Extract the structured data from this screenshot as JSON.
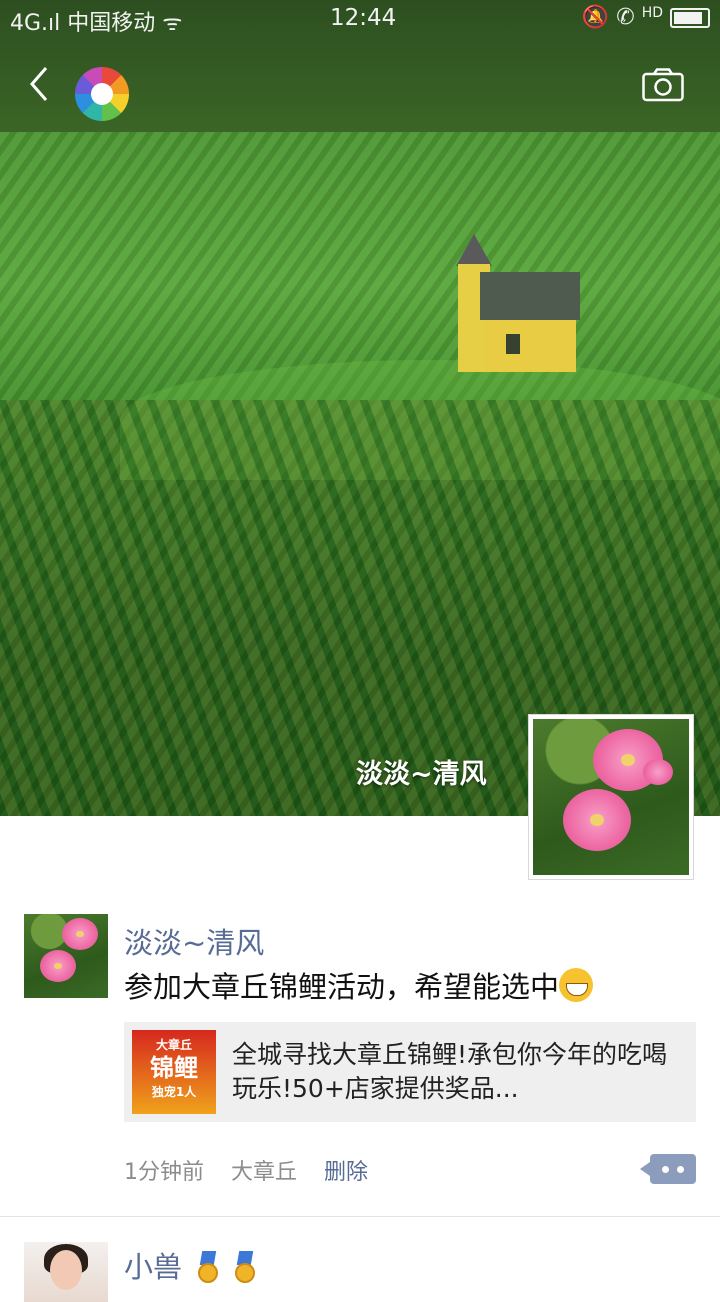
{
  "status_bar": {
    "carrier": "4G.ıl 中国移动 ᯤ",
    "time": "12:44",
    "hd": "HD"
  },
  "header": {
    "back_icon": "chevron-left-icon",
    "app_icon": "aperture-icon",
    "camera_icon": "camera-icon"
  },
  "cover": {
    "username": "淡淡~清风"
  },
  "post": {
    "author": "淡淡~清风",
    "text": "参加大章丘锦鲤活动，希望能选中",
    "emoji": "grinning-emoji",
    "link": {
      "thumb_top": "大章丘",
      "thumb_main": "锦鲤",
      "thumb_bottom": "独宠1人",
      "title": "全城寻找大章丘锦鲤!承包你今年的吃喝玩乐!50+店家提供奖品..."
    },
    "time": "1分钟前",
    "location": "大章丘",
    "delete_label": "删除",
    "more_icon": "more-comment-icon"
  },
  "post2": {
    "author": "小兽",
    "medal_icon": "medal-icon"
  },
  "colors": {
    "link_blue": "#576b95",
    "topbar_green": "#2d4f20"
  }
}
